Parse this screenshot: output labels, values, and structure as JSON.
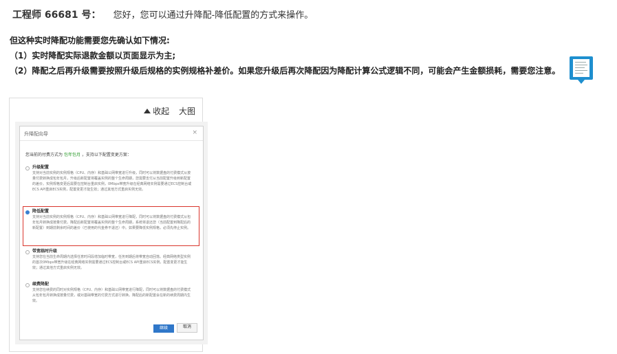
{
  "header": {
    "engineer": "工程师 66681 号：",
    "message": "您好，您可以通过升降配-降低配置的方式来操作。"
  },
  "note": {
    "lead": "但这种实时降配功能需要您先确认如下情况:",
    "item1": "（1）实时降配实际退款金额以页面显示为主;",
    "item2": "（2）降配之后再升级需要按照升级后规格的实例规格补差价。如果您升级后再次降配因为降配计算公式逻辑不同，可能会产生金额损耗，需要您注意。"
  },
  "panel": {
    "collapse": "收起",
    "enlarge": "大图"
  },
  "dialog": {
    "title": "升降配向导",
    "close": "×",
    "intro_prefix": "您当前的付费方式为",
    "intro_plan": "包年包月",
    "intro_suffix": "，支持以下配置变更方案：",
    "options": [
      {
        "title": "升级配置",
        "desc": "支持对当前实例的实例规格（CPU、内存）和基础公网带宽进行升级，同时可以将数据盘的付费模式从按量付费转换成包年包月，升级后新配置将覆盖实例的整个生命周期，您需要支付从当前配置升级到新配置的差价。实例规格变更后需要在控制台重启实例，0Mbps带宽升级在经典网络实例需要通过ECS控制台或ECS API重启ECS实例，配置变更才能生效；通过其他方式重启实例无效。"
      },
      {
        "title": "降低配置",
        "desc": "支持对当前实例的实例规格（CPU、内存）和基础公网带宽进行降配，同时可以将数据盘的付费模式从包年包月转换成按量付费。降配后新配置将覆盖实例的整个生命周期，系统将退还您（当前配置到降配后的新配置）到期前剩余时间的差价（已使用的代金券不退还）中。如果要降低实例规格，必须先停止实例。"
      },
      {
        "title": "带宽临时升级",
        "desc": "支持您在当前生命周期内选择任意时间段增加临时带宽，任务到期后将带宽自动回落。经典网络类型实例的首次0Mbps带宽升级在经典网络实例需要通过ECS控制台或ECS API重启ECS实例，配置变更才能生效；通过其他方式重启实例无效。"
      },
      {
        "title": "续费降配",
        "desc": "支持您在续费的同时对实例规格（CPU、内存）和基础公网带宽进行降配，同时可以将数据盘的付费模式从包年包月转换成按量付费，或对基础带宽的付费方式进行转换。降配后的新配置会在新的续费周期内生效。"
      }
    ],
    "ok": "继续",
    "cancel": "取消"
  }
}
